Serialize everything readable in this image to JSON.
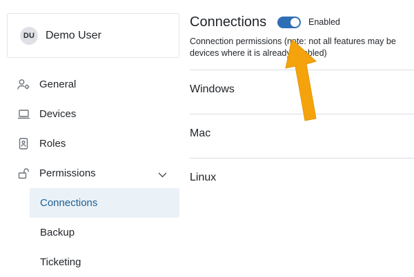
{
  "user": {
    "initials": "DU",
    "name": "Demo User"
  },
  "sidebar": {
    "items": [
      {
        "label": "General",
        "icon": "user-gear-icon"
      },
      {
        "label": "Devices",
        "icon": "laptop-icon"
      },
      {
        "label": "Roles",
        "icon": "id-badge-icon"
      },
      {
        "label": "Permissions",
        "icon": "unlock-icon",
        "expanded": true
      }
    ],
    "subitems": [
      {
        "label": "Connections",
        "active": true
      },
      {
        "label": "Backup",
        "active": false
      },
      {
        "label": "Ticketing",
        "active": false
      }
    ]
  },
  "main": {
    "title": "Connections",
    "toggle": {
      "state": "on",
      "label": "Enabled"
    },
    "description_line1": "Connection permissions (note: not all features may be",
    "description_line2": "devices where it is already enabled)",
    "os_rows": [
      "Windows",
      "Mac",
      "Linux"
    ]
  },
  "colors": {
    "accent": "#2f6eb5",
    "active_bg": "#eaf1f7",
    "active_text": "#1d5f93",
    "annotation_arrow": "#f5a30d"
  }
}
